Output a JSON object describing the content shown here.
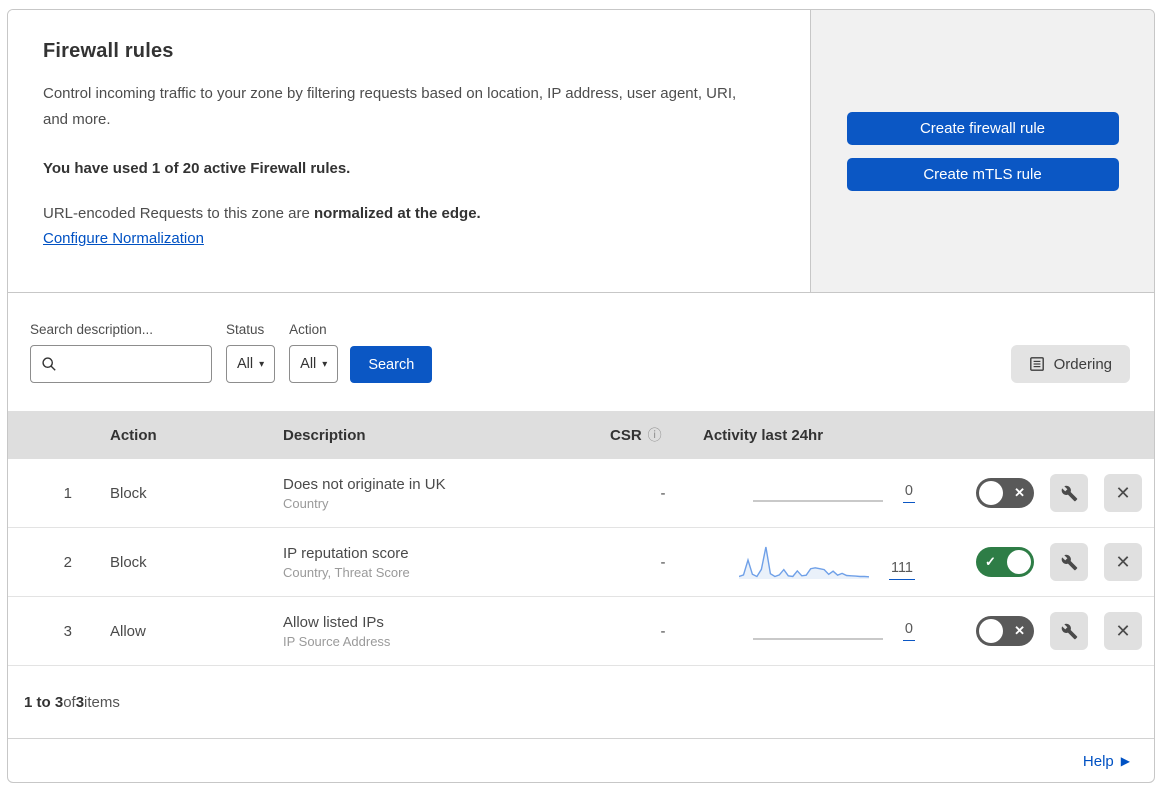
{
  "header": {
    "title": "Firewall rules",
    "description": "Control incoming traffic to your zone by filtering requests based on location, IP address, user agent, URI, and more.",
    "usage": "You have used 1 of 20 active Firewall rules.",
    "normalization_text": "URL-encoded Requests to this zone are ",
    "normalization_bold": "normalized at the edge.",
    "normalization_link": "Configure Normalization"
  },
  "actions_panel": {
    "create_firewall_rule": "Create firewall rule",
    "create_mtls_rule": "Create mTLS rule"
  },
  "filters": {
    "search_label": "Search description...",
    "search_value": "",
    "status_label": "Status",
    "status_value": "All",
    "action_label": "Action",
    "action_value": "All",
    "search_button": "Search",
    "ordering_button": "Ordering"
  },
  "table": {
    "columns": {
      "action": "Action",
      "description": "Description",
      "csr": "CSR",
      "activity": "Activity last 24hr"
    },
    "rows": [
      {
        "index": "1",
        "action": "Block",
        "description": "Does not originate in UK",
        "fields": "Country",
        "csr": "-",
        "activity_count": "0",
        "enabled": false
      },
      {
        "index": "2",
        "action": "Block",
        "description": "IP reputation score",
        "fields": "Country, Threat Score",
        "csr": "-",
        "activity_count": "111",
        "enabled": true
      },
      {
        "index": "3",
        "action": "Allow",
        "description": "Allow listed IPs",
        "fields": "IP Source Address",
        "csr": "-",
        "activity_count": "0",
        "enabled": false
      }
    ]
  },
  "footer": {
    "range": "1 to 3",
    "of": " of ",
    "total": "3",
    "items": " items",
    "help": "Help"
  },
  "icons": {
    "toggle_on": "✓",
    "toggle_off": "✕",
    "close": "✕",
    "caret": "▾",
    "info": "ⓘ",
    "help_arrow": "▶"
  },
  "colors": {
    "primary_blue": "#0b57c4",
    "link_blue": "#0051c3",
    "toggle_on_green": "#2e7d46",
    "toggle_off_gray": "#595959",
    "sparkline_blue": "#6fa0e8",
    "table_header_gray": "#dedede",
    "panel_gray": "#f1f1f1"
  },
  "chart_data": {
    "type": "area",
    "title": "Activity last 24hr sparkline (rule 2)",
    "total_label": "111",
    "values": [
      0.05,
      0.1,
      0.58,
      0.12,
      0.05,
      0.28,
      1.0,
      0.14,
      0.05,
      0.1,
      0.27,
      0.07,
      0.05,
      0.23,
      0.07,
      0.09,
      0.3,
      0.33,
      0.3,
      0.27,
      0.12,
      0.22,
      0.09,
      0.15,
      0.08,
      0.07,
      0.06,
      0.05,
      0.05,
      0.04
    ],
    "ylim": [
      0,
      1
    ],
    "grid": false,
    "legend": false
  }
}
